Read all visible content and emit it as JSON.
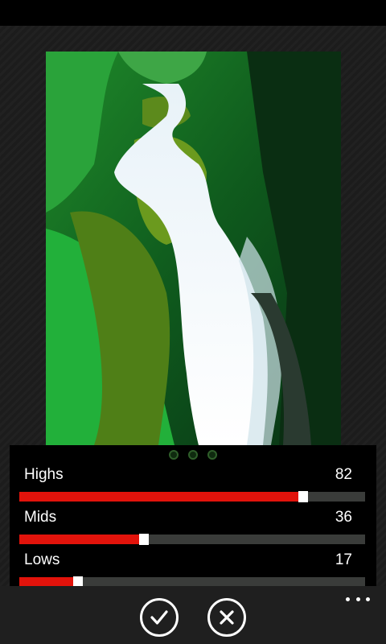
{
  "pager": {
    "pages": 3,
    "active": 0
  },
  "adjustments": [
    {
      "label": "Highs",
      "value": "82",
      "level": 82
    },
    {
      "label": "Mids",
      "value": "36",
      "level": 36
    },
    {
      "label": "Lows",
      "value": "17",
      "level": 17
    }
  ],
  "app_bar": {
    "confirm_icon": "check-icon",
    "cancel_icon": "close-icon",
    "more_icon": "ellipsis-icon"
  },
  "colors": {
    "slider_fill": "#e2130b",
    "slider_track": "#3a3c3a",
    "slider_thumb": "#ffffff"
  }
}
